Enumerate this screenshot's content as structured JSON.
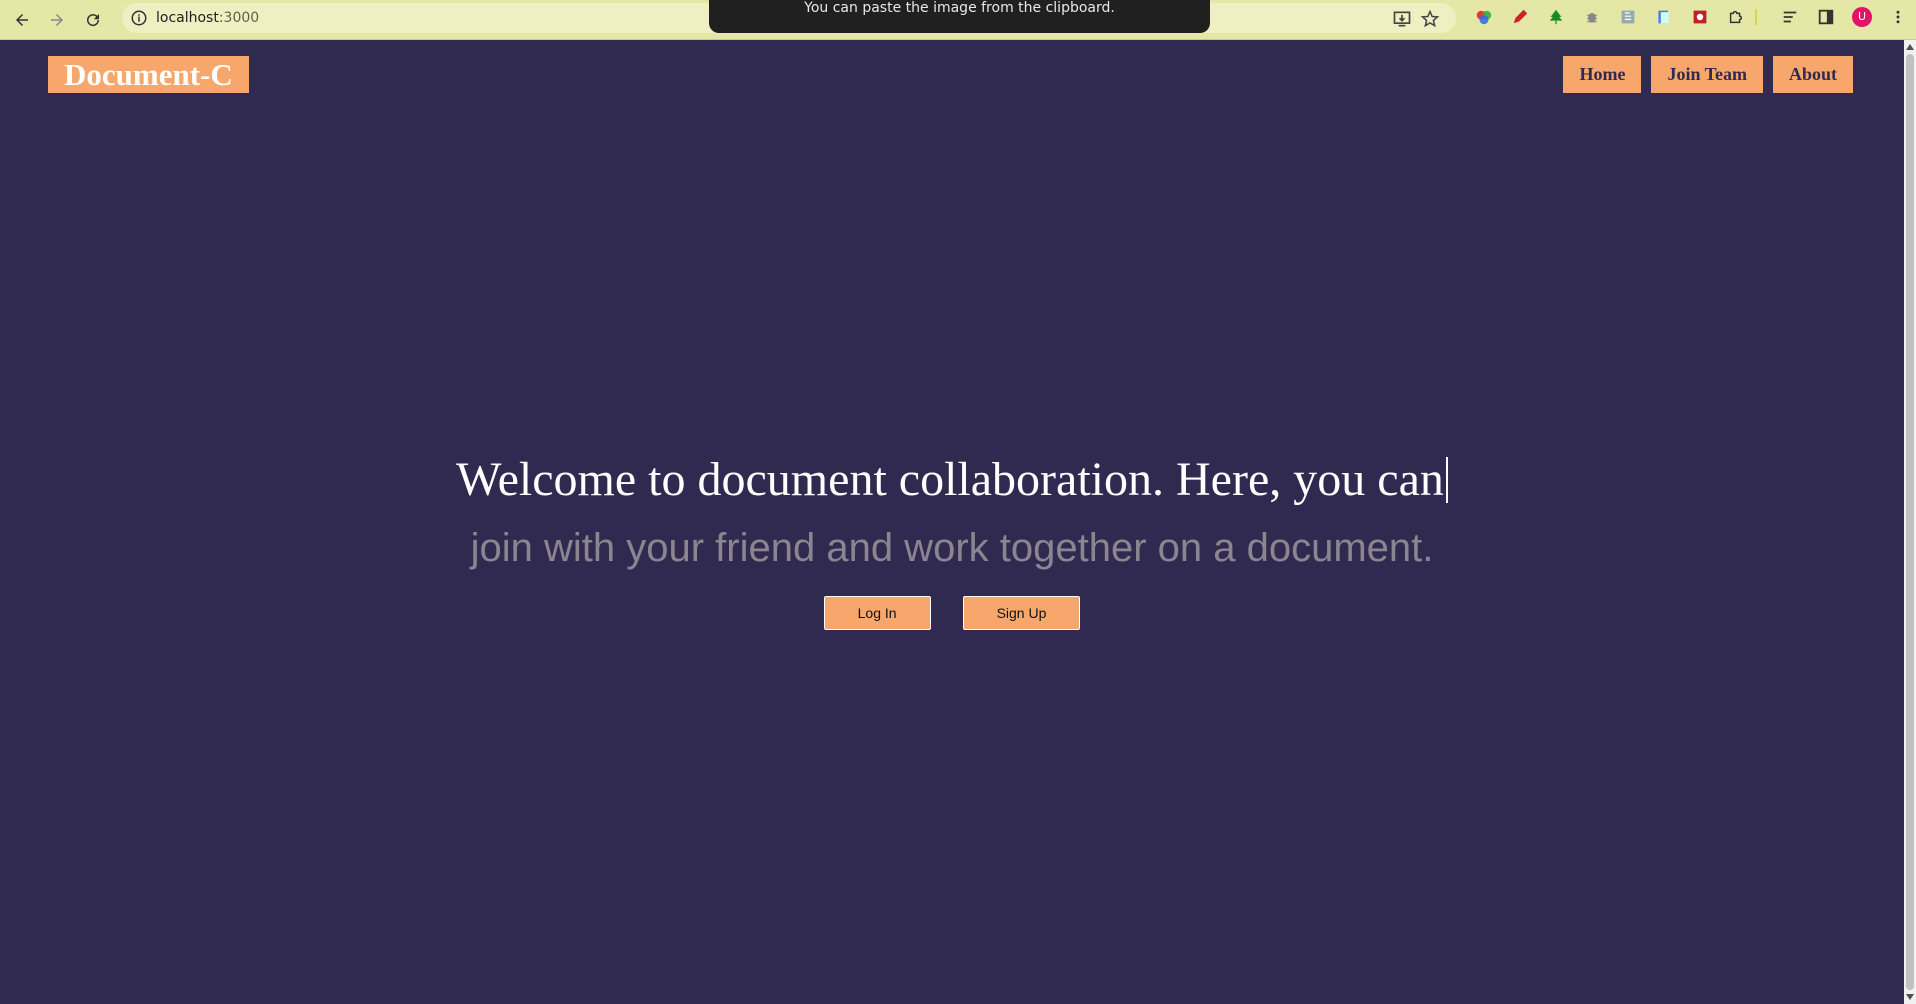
{
  "browser": {
    "url_host": "localhost",
    "url_port": ":3000",
    "toast": "You can paste the image from the clipboard.",
    "profile_initial": "U"
  },
  "site": {
    "logo_main": "Document-",
    "logo_tail": "C",
    "nav": [
      "Home",
      "Join Team",
      "About"
    ]
  },
  "hero": {
    "headline": "Welcome to document collaboration. Here, you can",
    "subline": "join with your friend and work together on a document.",
    "login_label": "Log In",
    "signup_label": "Sign Up"
  },
  "colors": {
    "background": "#312a50",
    "accent": "#f7a76b",
    "chrome": "#e4e7a6"
  }
}
